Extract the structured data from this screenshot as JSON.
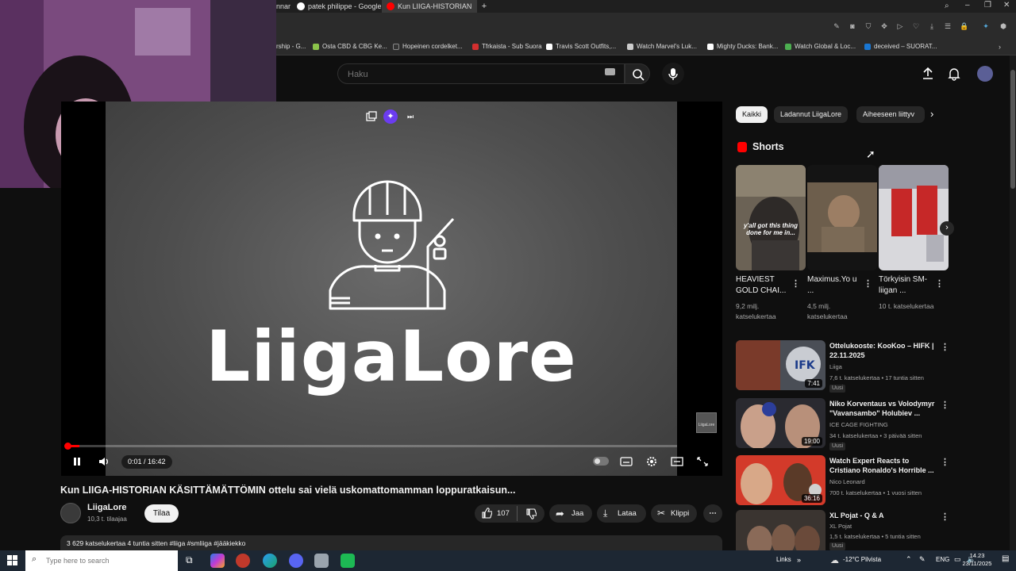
{
  "browser": {
    "tabs": [
      {
        "label": "nnar",
        "active": false
      },
      {
        "label": "patek philippe - Google-h",
        "active": false
      },
      {
        "label": "Kun LIIGA-HISTORIAN",
        "active": true
      }
    ],
    "new_tab_label": "+",
    "bookmarks": [
      "rship - G...",
      "Osta CBD & CBG Ke...",
      "Hopeinen cordelket...",
      "Tfrkaista - Sub Suora",
      "Travis Scott Outfits,...",
      "Watch Marvel's Luk...",
      "Mighty Ducks: Bank...",
      "Watch Global & Loc...",
      "deceived – SUORAT..."
    ]
  },
  "header": {
    "search_placeholder": "Haku"
  },
  "player": {
    "logo_text": "LiigaLore",
    "watermark": "LiigaLore",
    "time": "0:01 / 16:42",
    "progress": 0.001
  },
  "video": {
    "title": "Kun LIIGA-HISTORIAN KÄSITTÄMÄTTÖMIN ottelu sai vielä uskomattomamman loppuratkaisun...",
    "channel": "LiigaLore",
    "subscribers": "10,3 t. tilaajaa",
    "subscribe_label": "Tilaa",
    "likes": "107",
    "share_label": "Jaa",
    "download_label": "Lataa",
    "clip_label": "Klippi",
    "description": "3 629 katselukertaa  4 tuntia sitten  #liiga #smliiga #jääkiekko"
  },
  "sidebar": {
    "chips": [
      "Kaikki",
      "Ladannut LiigaLore",
      "Aiheeseen liittyv"
    ],
    "shorts_heading": "Shorts",
    "shorts": [
      {
        "title": "HEAVIEST GOLD CHAI...",
        "views": "9,2 milj. katselukertaa",
        "caption": "y'all got this thing done for me in..."
      },
      {
        "title": "Maximus.Yo u ...",
        "views": "4,5 milj. katselukertaa",
        "caption": ""
      },
      {
        "title": "Törkyisin SM-liigan ...",
        "views": "10 t. katselukertaa",
        "caption": ""
      }
    ],
    "recommendations": [
      {
        "title": "Ottelukooste: KooKoo – HIFK | 22.11.2025",
        "channel": "Liiga",
        "meta": "7,6 t. katselukertaa • 17 tuntia sitten",
        "duration": "7:41",
        "badge": "Uusi"
      },
      {
        "title": "Niko Korventaus vs Volodymyr \"Vavansambo\" Holubiev ...",
        "channel": "ICE CAGE FIGHTING",
        "meta": "34 t. katselukertaa • 3 päivää sitten",
        "duration": "19:00",
        "badge": "Uusi"
      },
      {
        "title": "Watch Expert Reacts to Cristiano Ronaldo's Horrible ...",
        "channel": "Nico Leonard",
        "meta": "700 t. katselukertaa • 1 vuosi sitten",
        "duration": "36:16",
        "badge": ""
      },
      {
        "title": "XL Pojat - Q & A",
        "channel": "XL Pojat",
        "meta": "1,5 t. katselukertaa • 5 tuntia sitten",
        "duration": "",
        "badge": "Uusi"
      }
    ]
  },
  "taskbar": {
    "search_placeholder": "Type here to search",
    "links_label": "Links",
    "weather": "-12°C Pilvista",
    "language": "ENG",
    "time": "14.23",
    "date": "23/11/2025"
  },
  "colors": {
    "background": "#0f0f0f",
    "accent": "#ff0000",
    "chip_active": "#f1f1f1"
  }
}
